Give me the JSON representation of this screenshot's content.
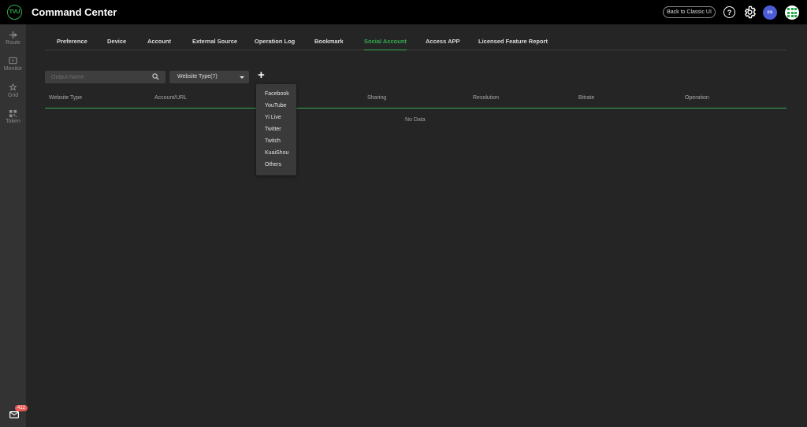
{
  "header": {
    "logo_text": "TVU",
    "title": "Command Center",
    "classic_label": "Back to Classic UI",
    "help_glyph": "?",
    "avatar_initials": "cs",
    "icons": [
      "help-icon",
      "gear-icon",
      "apps-grid-icon"
    ]
  },
  "sidebar": {
    "items": [
      {
        "label": "Route",
        "icon": "route-icon"
      },
      {
        "label": "Monitor",
        "icon": "monitor-icon"
      },
      {
        "label": "Grid",
        "icon": "grid-icon"
      },
      {
        "label": "Token",
        "icon": "qr-token-icon"
      }
    ],
    "mail_badge": "412"
  },
  "tabs": [
    {
      "label": "Preference"
    },
    {
      "label": "Device"
    },
    {
      "label": "Account"
    },
    {
      "label": "External Source"
    },
    {
      "label": "Operation Log"
    },
    {
      "label": "Bookmark"
    },
    {
      "label": "Social Account",
      "active": true
    },
    {
      "label": "Access APP"
    },
    {
      "label": "Licensed Feature Report"
    }
  ],
  "toolbar": {
    "search_placeholder": "Output Name",
    "website_type_label": "Website Type(7)",
    "add_glyph": "+"
  },
  "table": {
    "columns": [
      "Website Type",
      "Account/URL",
      "Sharing",
      "Resolution",
      "Bitrate",
      "Operation"
    ],
    "empty_text": "No Data"
  },
  "dropdown": {
    "options": [
      "Facebook",
      "YouTube",
      "Yi Live",
      "Twitter",
      "Twitch",
      "KuaiShou",
      "Others"
    ]
  },
  "colors": {
    "accent": "#33ab4f",
    "background": "#252525",
    "header": "#000000",
    "sidebar": "#333333",
    "avatar": "#4b5cd6",
    "badge": "#ee5a55"
  }
}
